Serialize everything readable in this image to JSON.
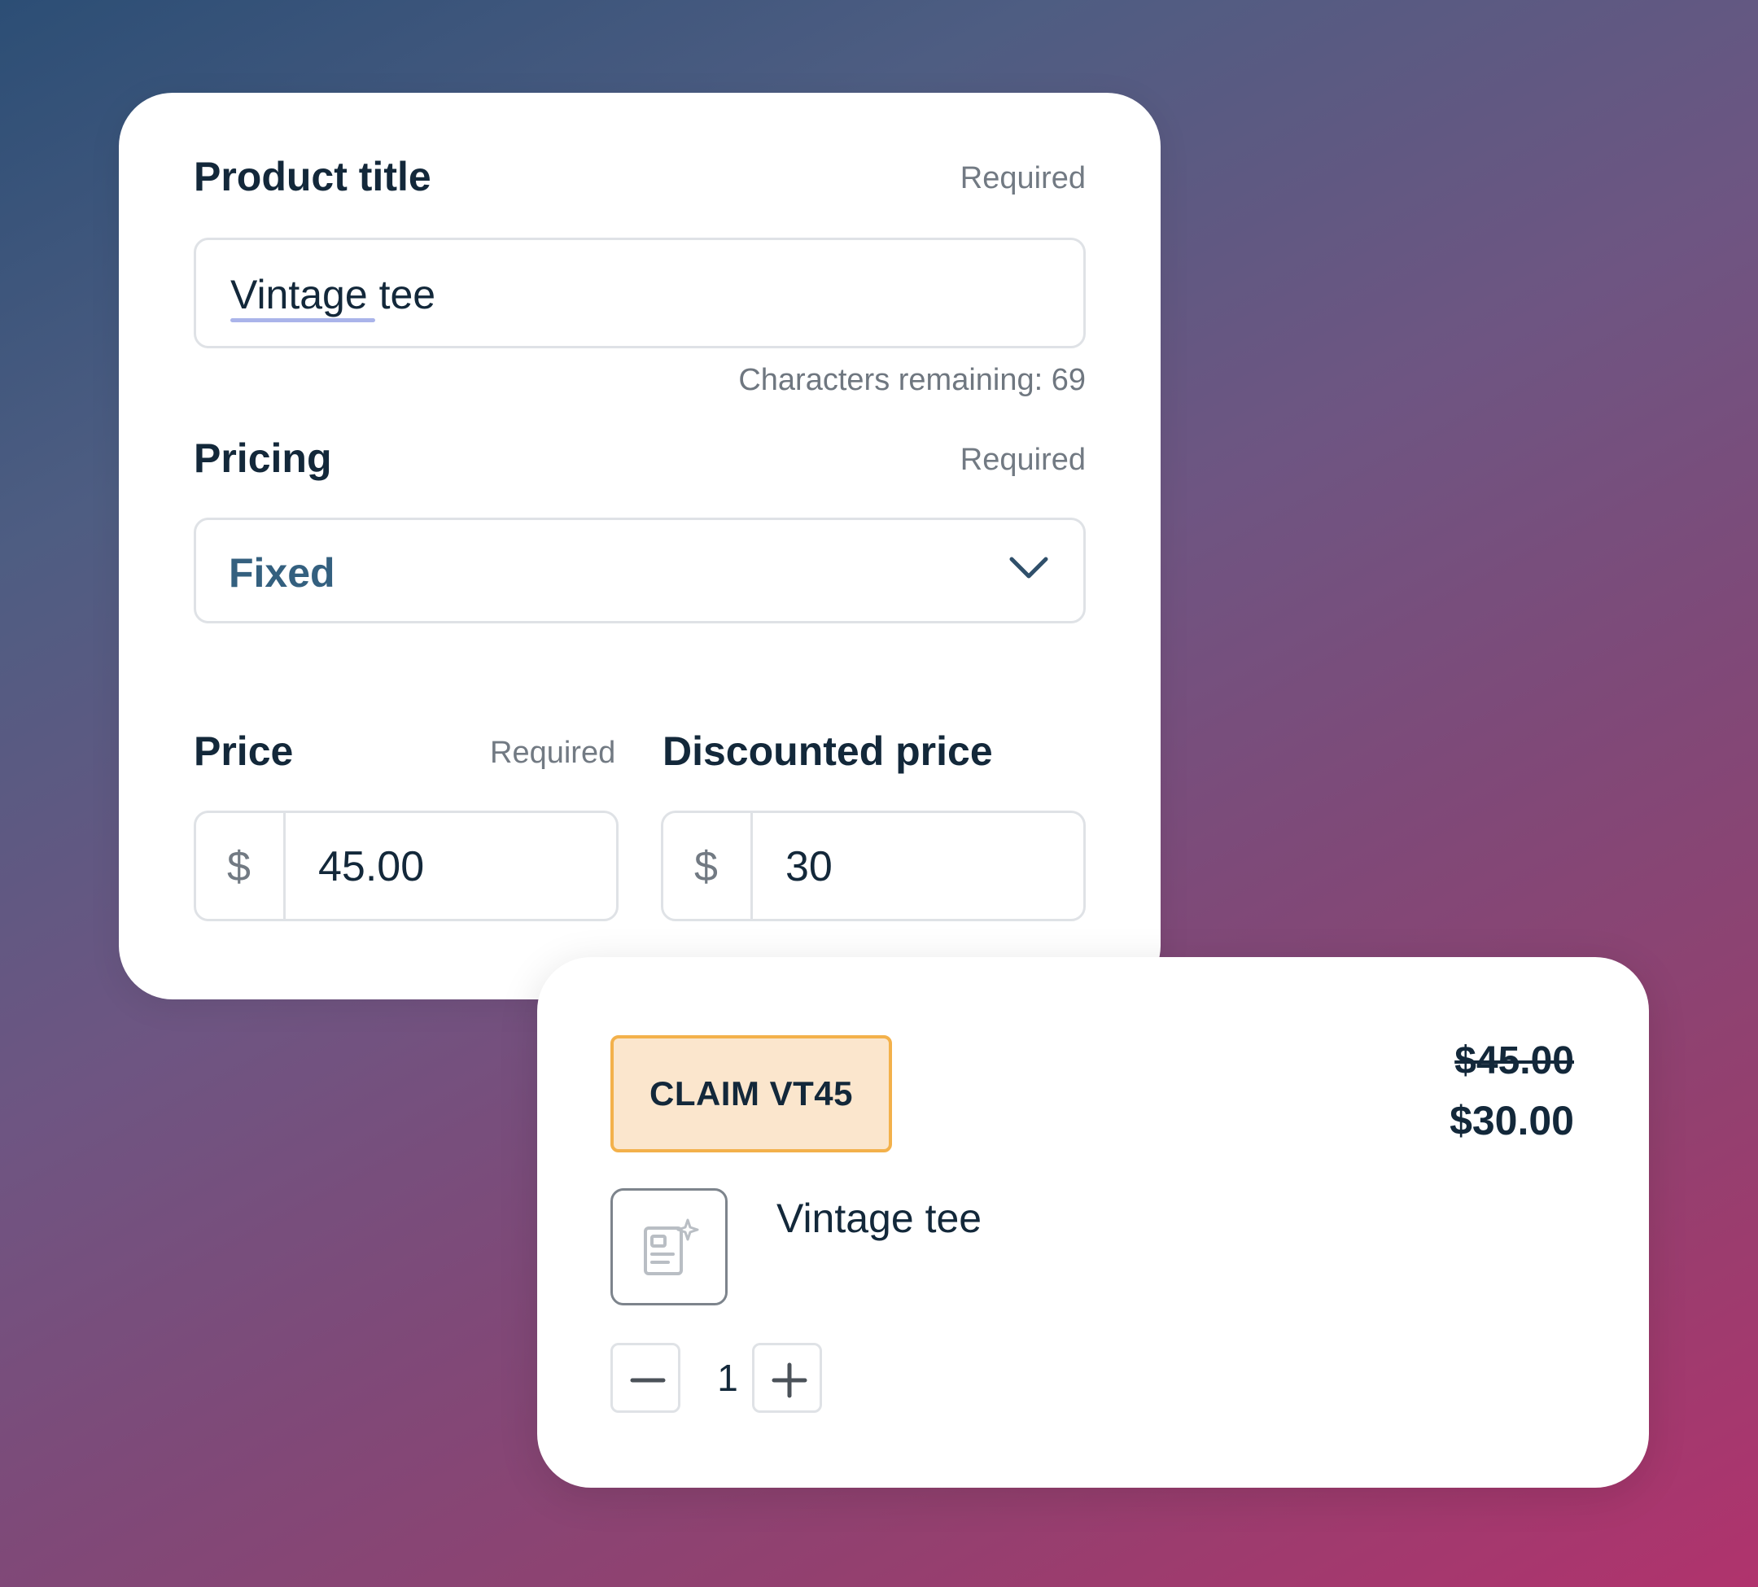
{
  "form": {
    "product_title": {
      "label": "Product title",
      "required": "Required",
      "value": "Vintage tee",
      "hint": "Characters remaining: 69"
    },
    "pricing": {
      "label": "Pricing",
      "required": "Required",
      "value": "Fixed",
      "icon": "chevron-down-icon"
    },
    "price": {
      "label": "Price",
      "required": "Required",
      "prefix": "$",
      "value": "45.00"
    },
    "discounted_price": {
      "label": "Discounted price",
      "prefix": "$",
      "value": "30"
    }
  },
  "product": {
    "coupon": "CLAIM VT45",
    "old_price": "$45.00",
    "new_price": "$30.00",
    "name": "Vintage tee",
    "thumbnail_icon": "image-placeholder-icon",
    "quantity": "1",
    "decrement_icon": "minus-icon",
    "increment_icon": "plus-icon"
  },
  "colors": {
    "text_primary": "#13283a",
    "select_value": "#34607f",
    "coupon_bg": "#fbe6cd",
    "coupon_border": "#f3b14b",
    "border": "#dfe2e6",
    "muted": "#727a83"
  }
}
